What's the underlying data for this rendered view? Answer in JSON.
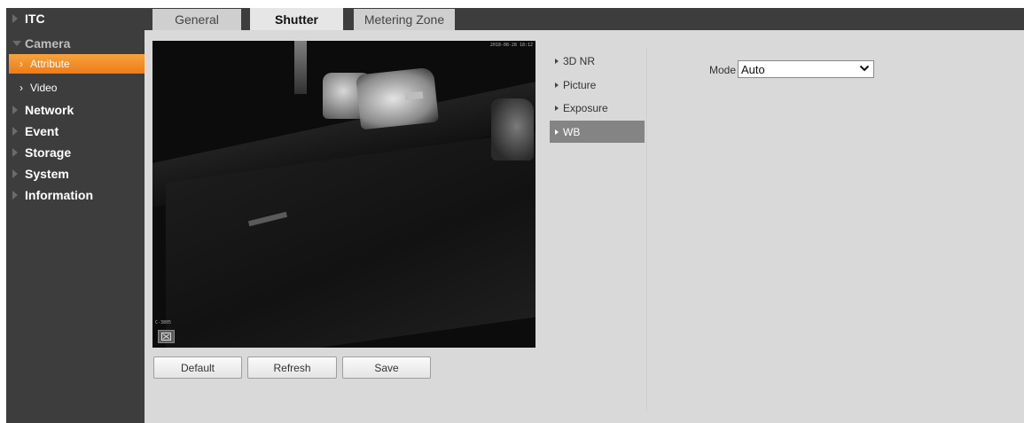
{
  "sidebar": {
    "items": [
      {
        "label": "ITC"
      },
      {
        "label": "Camera"
      },
      {
        "label": "Attribute"
      },
      {
        "label": "Video"
      },
      {
        "label": "Network"
      },
      {
        "label": "Event"
      },
      {
        "label": "Storage"
      },
      {
        "label": "System"
      },
      {
        "label": "Information"
      }
    ]
  },
  "tabs": [
    {
      "label": "General"
    },
    {
      "label": "Shutter"
    },
    {
      "label": "Metering Zone"
    }
  ],
  "video": {
    "osd_top_right": "2018-08-28 18:12",
    "osd_bottom_left": "C-3805"
  },
  "buttons": {
    "default_label": "Default",
    "refresh_label": "Refresh",
    "save_label": "Save"
  },
  "submenu": [
    {
      "label": "3D NR"
    },
    {
      "label": "Picture"
    },
    {
      "label": "Exposure"
    },
    {
      "label": "WB"
    }
  ],
  "settings": {
    "mode_label": "Mode",
    "mode_value": "Auto"
  }
}
